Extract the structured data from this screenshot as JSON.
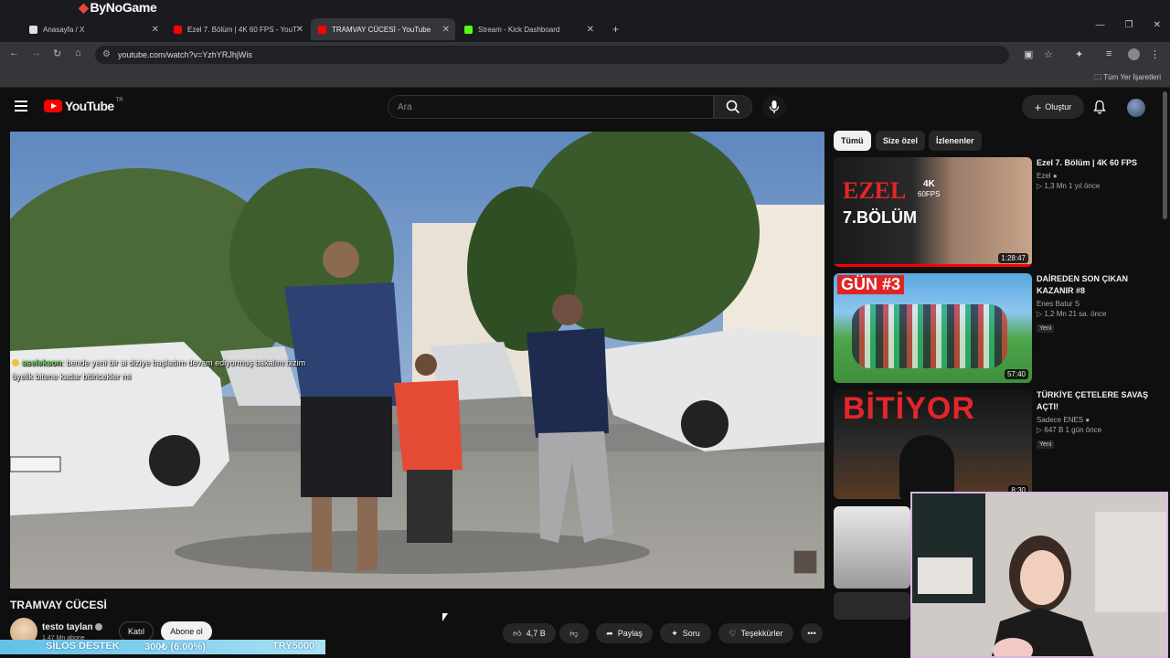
{
  "stream_overlay": {
    "logo_text": "ByNoGame"
  },
  "browser": {
    "tabs": [
      {
        "label": "Anasayfa / X",
        "favicon_color": "#e0e0e0"
      },
      {
        "label": "Ezel 7. Bölüm | 4K 60 FPS - YouT",
        "favicon_color": "#ff0000"
      },
      {
        "label": "TRAMVAY CÜCESİ - YouTube",
        "favicon_color": "#ff0000"
      },
      {
        "label": "Stream - Kick Dashboard",
        "favicon_color": "#53fc18"
      }
    ],
    "url": "youtube.com/watch?v=YzhYRJhjWis",
    "bookmarks_label": "Tüm Yer İşaretleri"
  },
  "header": {
    "logo_text": "YouTube",
    "country_code": "TR",
    "search_placeholder": "Ara",
    "create_label": "Oluştur"
  },
  "player": {
    "chat_user": "aselekson",
    "chat_line1": ": bende yeni bir ai diziye başladım devam ediyormuş bakalım bizim",
    "chat_line2": "üyelik bitene kadar bitiricekler mi"
  },
  "video": {
    "title": "TRAMVAY CÜCESİ",
    "channel": "testo taylan",
    "subscribers": "1,47 Mn abone",
    "join_label": "Katıl",
    "subscribe_label": "Abone ol",
    "likes": "4,7 B",
    "share_label": "Paylaş",
    "ask_label": "Soru",
    "thanks_label": "Teşekkürler"
  },
  "donation": {
    "label": "SİLOS DESTEK",
    "progress": "300₺ (6.00%)",
    "goal": "TRY5000"
  },
  "sidebar": {
    "chips": [
      {
        "label": "Tümü"
      },
      {
        "label": "Size özel"
      },
      {
        "label": "İzlenenler"
      }
    ],
    "recommendations": [
      {
        "title": "Ezel 7. Bölüm | 4K 60 FPS",
        "channel": "Ezel",
        "stats": "1,3 Mn   1 yıl önce",
        "duration": "1:28:47",
        "badge": "",
        "thumb_text1": "EZEL",
        "thumb_text2": "4K",
        "thumb_text3": "60FPS",
        "thumb_text4": "7.BÖLÜM"
      },
      {
        "title": "DAİREDEN SON ÇIKAN KAZANIR #8",
        "channel": "Enes Batur S",
        "stats": "1,2 Mn   21 sa. önce",
        "duration": "57:40",
        "badge": "Yeni",
        "thumb_text1": "GÜN #3"
      },
      {
        "title": "TÜRKİYE ÇETELERE SAVAŞ AÇTI!",
        "channel": "Sadece ENES",
        "stats": "647 B   1 gün önce",
        "duration": "8:30",
        "badge": "Yeni",
        "thumb_text1": "BİTİYOR"
      }
    ]
  }
}
